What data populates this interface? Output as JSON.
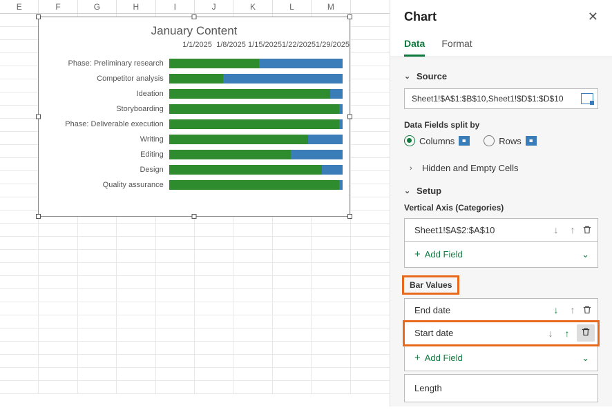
{
  "columns": [
    "E",
    "F",
    "G",
    "H",
    "I",
    "J",
    "K",
    "L",
    "M"
  ],
  "chart_data": {
    "type": "bar",
    "title": "January Content",
    "x_ticks": [
      "1/1/2025",
      "1/8/2025",
      "1/15/2025",
      "1/22/2025",
      "1/29/2025"
    ],
    "categories": [
      "Phase: Preliminary research",
      "Competitor analysis",
      "Ideation",
      "Storyboarding",
      "Phase: Deliverable execution",
      "Writing",
      "Editing",
      "Design",
      "Quality assurance"
    ],
    "series": [
      {
        "name": "Start date",
        "color": "#2e8b2e",
        "values": [
          52,
          31,
          93,
          98,
          98,
          80,
          70,
          88,
          98
        ]
      },
      {
        "name": "End date",
        "color": "#3a7db8",
        "values": [
          48,
          69,
          7,
          2,
          2,
          20,
          30,
          12,
          2
        ]
      }
    ]
  },
  "panel": {
    "title": "Chart",
    "tabs": {
      "data": "Data",
      "format": "Format"
    },
    "source": {
      "label": "Source",
      "range": "Sheet1!$A$1:$B$10,Sheet1!$D$1:$D$10",
      "split_label": "Data Fields split by",
      "columns": "Columns",
      "rows": "Rows",
      "hidden": "Hidden and Empty Cells"
    },
    "setup": {
      "label": "Setup",
      "vaxis_label": "Vertical Axis (Categories)",
      "vaxis_value": "Sheet1!$A$2:$A$10",
      "add_field": "Add Field",
      "bar_values_label": "Bar Values",
      "bar_items": [
        {
          "label": "End date"
        },
        {
          "label": "Start date"
        }
      ],
      "length": "Length"
    }
  }
}
